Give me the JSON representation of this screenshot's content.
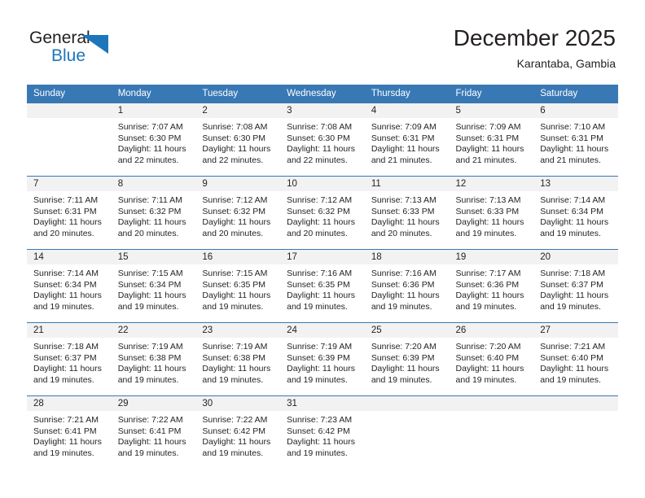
{
  "logo": {
    "word1": "General",
    "word2": "Blue",
    "triangle_color": "#1d76bb",
    "text_color": "#231f20"
  },
  "header": {
    "title": "December 2025",
    "subtitle": "Karantaba, Gambia"
  },
  "theme": {
    "header_blue": "#3878b4",
    "daynum_gray": "#f2f2f2",
    "text": "#231f20"
  },
  "calendar": {
    "weekday_headers": [
      "Sunday",
      "Monday",
      "Tuesday",
      "Wednesday",
      "Thursday",
      "Friday",
      "Saturday"
    ],
    "weeks": [
      [
        {
          "day": "",
          "sunrise": "",
          "sunset": "",
          "daylight": "",
          "daylight2": ""
        },
        {
          "day": "1",
          "sunrise": "Sunrise: 7:07 AM",
          "sunset": "Sunset: 6:30 PM",
          "daylight": "Daylight: 11 hours",
          "daylight2": "and 22 minutes."
        },
        {
          "day": "2",
          "sunrise": "Sunrise: 7:08 AM",
          "sunset": "Sunset: 6:30 PM",
          "daylight": "Daylight: 11 hours",
          "daylight2": "and 22 minutes."
        },
        {
          "day": "3",
          "sunrise": "Sunrise: 7:08 AM",
          "sunset": "Sunset: 6:30 PM",
          "daylight": "Daylight: 11 hours",
          "daylight2": "and 22 minutes."
        },
        {
          "day": "4",
          "sunrise": "Sunrise: 7:09 AM",
          "sunset": "Sunset: 6:31 PM",
          "daylight": "Daylight: 11 hours",
          "daylight2": "and 21 minutes."
        },
        {
          "day": "5",
          "sunrise": "Sunrise: 7:09 AM",
          "sunset": "Sunset: 6:31 PM",
          "daylight": "Daylight: 11 hours",
          "daylight2": "and 21 minutes."
        },
        {
          "day": "6",
          "sunrise": "Sunrise: 7:10 AM",
          "sunset": "Sunset: 6:31 PM",
          "daylight": "Daylight: 11 hours",
          "daylight2": "and 21 minutes."
        }
      ],
      [
        {
          "day": "7",
          "sunrise": "Sunrise: 7:11 AM",
          "sunset": "Sunset: 6:31 PM",
          "daylight": "Daylight: 11 hours",
          "daylight2": "and 20 minutes."
        },
        {
          "day": "8",
          "sunrise": "Sunrise: 7:11 AM",
          "sunset": "Sunset: 6:32 PM",
          "daylight": "Daylight: 11 hours",
          "daylight2": "and 20 minutes."
        },
        {
          "day": "9",
          "sunrise": "Sunrise: 7:12 AM",
          "sunset": "Sunset: 6:32 PM",
          "daylight": "Daylight: 11 hours",
          "daylight2": "and 20 minutes."
        },
        {
          "day": "10",
          "sunrise": "Sunrise: 7:12 AM",
          "sunset": "Sunset: 6:32 PM",
          "daylight": "Daylight: 11 hours",
          "daylight2": "and 20 minutes."
        },
        {
          "day": "11",
          "sunrise": "Sunrise: 7:13 AM",
          "sunset": "Sunset: 6:33 PM",
          "daylight": "Daylight: 11 hours",
          "daylight2": "and 20 minutes."
        },
        {
          "day": "12",
          "sunrise": "Sunrise: 7:13 AM",
          "sunset": "Sunset: 6:33 PM",
          "daylight": "Daylight: 11 hours",
          "daylight2": "and 19 minutes."
        },
        {
          "day": "13",
          "sunrise": "Sunrise: 7:14 AM",
          "sunset": "Sunset: 6:34 PM",
          "daylight": "Daylight: 11 hours",
          "daylight2": "and 19 minutes."
        }
      ],
      [
        {
          "day": "14",
          "sunrise": "Sunrise: 7:14 AM",
          "sunset": "Sunset: 6:34 PM",
          "daylight": "Daylight: 11 hours",
          "daylight2": "and 19 minutes."
        },
        {
          "day": "15",
          "sunrise": "Sunrise: 7:15 AM",
          "sunset": "Sunset: 6:34 PM",
          "daylight": "Daylight: 11 hours",
          "daylight2": "and 19 minutes."
        },
        {
          "day": "16",
          "sunrise": "Sunrise: 7:15 AM",
          "sunset": "Sunset: 6:35 PM",
          "daylight": "Daylight: 11 hours",
          "daylight2": "and 19 minutes."
        },
        {
          "day": "17",
          "sunrise": "Sunrise: 7:16 AM",
          "sunset": "Sunset: 6:35 PM",
          "daylight": "Daylight: 11 hours",
          "daylight2": "and 19 minutes."
        },
        {
          "day": "18",
          "sunrise": "Sunrise: 7:16 AM",
          "sunset": "Sunset: 6:36 PM",
          "daylight": "Daylight: 11 hours",
          "daylight2": "and 19 minutes."
        },
        {
          "day": "19",
          "sunrise": "Sunrise: 7:17 AM",
          "sunset": "Sunset: 6:36 PM",
          "daylight": "Daylight: 11 hours",
          "daylight2": "and 19 minutes."
        },
        {
          "day": "20",
          "sunrise": "Sunrise: 7:18 AM",
          "sunset": "Sunset: 6:37 PM",
          "daylight": "Daylight: 11 hours",
          "daylight2": "and 19 minutes."
        }
      ],
      [
        {
          "day": "21",
          "sunrise": "Sunrise: 7:18 AM",
          "sunset": "Sunset: 6:37 PM",
          "daylight": "Daylight: 11 hours",
          "daylight2": "and 19 minutes."
        },
        {
          "day": "22",
          "sunrise": "Sunrise: 7:19 AM",
          "sunset": "Sunset: 6:38 PM",
          "daylight": "Daylight: 11 hours",
          "daylight2": "and 19 minutes."
        },
        {
          "day": "23",
          "sunrise": "Sunrise: 7:19 AM",
          "sunset": "Sunset: 6:38 PM",
          "daylight": "Daylight: 11 hours",
          "daylight2": "and 19 minutes."
        },
        {
          "day": "24",
          "sunrise": "Sunrise: 7:19 AM",
          "sunset": "Sunset: 6:39 PM",
          "daylight": "Daylight: 11 hours",
          "daylight2": "and 19 minutes."
        },
        {
          "day": "25",
          "sunrise": "Sunrise: 7:20 AM",
          "sunset": "Sunset: 6:39 PM",
          "daylight": "Daylight: 11 hours",
          "daylight2": "and 19 minutes."
        },
        {
          "day": "26",
          "sunrise": "Sunrise: 7:20 AM",
          "sunset": "Sunset: 6:40 PM",
          "daylight": "Daylight: 11 hours",
          "daylight2": "and 19 minutes."
        },
        {
          "day": "27",
          "sunrise": "Sunrise: 7:21 AM",
          "sunset": "Sunset: 6:40 PM",
          "daylight": "Daylight: 11 hours",
          "daylight2": "and 19 minutes."
        }
      ],
      [
        {
          "day": "28",
          "sunrise": "Sunrise: 7:21 AM",
          "sunset": "Sunset: 6:41 PM",
          "daylight": "Daylight: 11 hours",
          "daylight2": "and 19 minutes."
        },
        {
          "day": "29",
          "sunrise": "Sunrise: 7:22 AM",
          "sunset": "Sunset: 6:41 PM",
          "daylight": "Daylight: 11 hours",
          "daylight2": "and 19 minutes."
        },
        {
          "day": "30",
          "sunrise": "Sunrise: 7:22 AM",
          "sunset": "Sunset: 6:42 PM",
          "daylight": "Daylight: 11 hours",
          "daylight2": "and 19 minutes."
        },
        {
          "day": "31",
          "sunrise": "Sunrise: 7:23 AM",
          "sunset": "Sunset: 6:42 PM",
          "daylight": "Daylight: 11 hours",
          "daylight2": "and 19 minutes."
        },
        {
          "day": "",
          "sunrise": "",
          "sunset": "",
          "daylight": "",
          "daylight2": ""
        },
        {
          "day": "",
          "sunrise": "",
          "sunset": "",
          "daylight": "",
          "daylight2": ""
        },
        {
          "day": "",
          "sunrise": "",
          "sunset": "",
          "daylight": "",
          "daylight2": ""
        }
      ]
    ]
  }
}
